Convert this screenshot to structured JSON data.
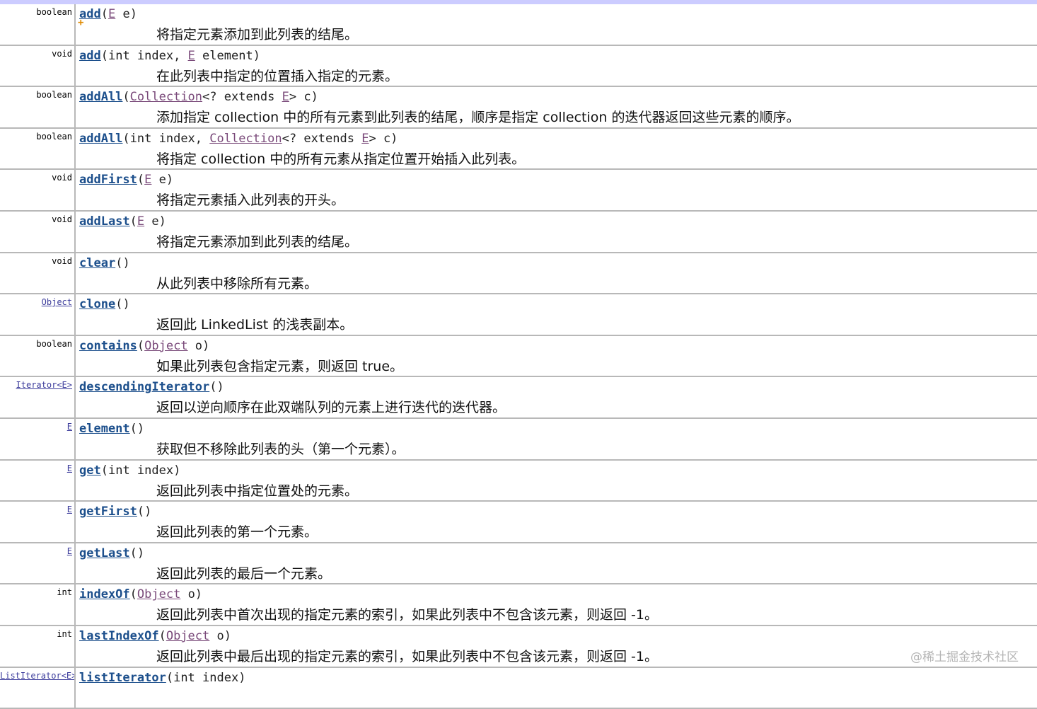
{
  "rows": [
    {
      "ret": "boolean",
      "ret_link": false,
      "method": "add",
      "params": [
        {
          "t": "p",
          "v": "E"
        },
        {
          "t": "s",
          "v": " e)"
        }
      ],
      "desc": "将指定元素添加到此列表的结尾。"
    },
    {
      "ret": "void",
      "ret_link": false,
      "method": "add",
      "params": [
        {
          "t": "s",
          "v": "int index, "
        },
        {
          "t": "p",
          "v": "E"
        },
        {
          "t": "s",
          "v": " element)"
        }
      ],
      "desc": "在此列表中指定的位置插入指定的元素。"
    },
    {
      "ret": "boolean",
      "ret_link": false,
      "method": "addAll",
      "params": [
        {
          "t": "p",
          "v": "Collection"
        },
        {
          "t": "s",
          "v": "<? extends "
        },
        {
          "t": "p",
          "v": "E"
        },
        {
          "t": "s",
          "v": "> c)"
        }
      ],
      "desc": "添加指定 collection 中的所有元素到此列表的结尾，顺序是指定 collection 的迭代器返回这些元素的顺序。"
    },
    {
      "ret": "boolean",
      "ret_link": false,
      "method": "addAll",
      "params": [
        {
          "t": "s",
          "v": "int index, "
        },
        {
          "t": "p",
          "v": "Collection"
        },
        {
          "t": "s",
          "v": "<? extends "
        },
        {
          "t": "p",
          "v": "E"
        },
        {
          "t": "s",
          "v": "> c)"
        }
      ],
      "desc": "将指定 collection 中的所有元素从指定位置开始插入此列表。"
    },
    {
      "ret": "void",
      "ret_link": false,
      "method": "addFirst",
      "params": [
        {
          "t": "p",
          "v": "E"
        },
        {
          "t": "s",
          "v": " e)"
        }
      ],
      "desc": "将指定元素插入此列表的开头。"
    },
    {
      "ret": "void",
      "ret_link": false,
      "method": "addLast",
      "params": [
        {
          "t": "p",
          "v": "E"
        },
        {
          "t": "s",
          "v": " e)"
        }
      ],
      "desc": "将指定元素添加到此列表的结尾。"
    },
    {
      "ret": "void",
      "ret_link": false,
      "method": "clear",
      "params": [
        {
          "t": "s",
          "v": ")"
        }
      ],
      "desc": "从此列表中移除所有元素。"
    },
    {
      "ret": "Object",
      "ret_link": true,
      "method": "clone",
      "params": [
        {
          "t": "s",
          "v": ")"
        }
      ],
      "desc": "返回此 LinkedList 的浅表副本。"
    },
    {
      "ret": "boolean",
      "ret_link": false,
      "method": "contains",
      "params": [
        {
          "t": "p",
          "v": "Object"
        },
        {
          "t": "s",
          "v": " o)"
        }
      ],
      "desc": "如果此列表包含指定元素，则返回 true。"
    },
    {
      "ret": "Iterator<E>",
      "ret_link": true,
      "method": "descendingIterator",
      "params": [
        {
          "t": "s",
          "v": ")"
        }
      ],
      "desc": "返回以逆向顺序在此双端队列的元素上进行迭代的迭代器。"
    },
    {
      "ret": "E",
      "ret_link": true,
      "method": "element",
      "params": [
        {
          "t": "s",
          "v": ")"
        }
      ],
      "desc": "获取但不移除此列表的头（第一个元素）。"
    },
    {
      "ret": "E",
      "ret_link": true,
      "method": "get",
      "params": [
        {
          "t": "s",
          "v": "int index)"
        }
      ],
      "desc": "返回此列表中指定位置处的元素。"
    },
    {
      "ret": "E",
      "ret_link": true,
      "method": "getFirst",
      "params": [
        {
          "t": "s",
          "v": ")"
        }
      ],
      "desc": "返回此列表的第一个元素。"
    },
    {
      "ret": "E",
      "ret_link": true,
      "method": "getLast",
      "params": [
        {
          "t": "s",
          "v": ")"
        }
      ],
      "desc": "返回此列表的最后一个元素。"
    },
    {
      "ret": "int",
      "ret_link": false,
      "method": "indexOf",
      "params": [
        {
          "t": "p",
          "v": "Object"
        },
        {
          "t": "s",
          "v": " o)"
        }
      ],
      "desc": "返回此列表中首次出现的指定元素的索引，如果此列表中不包含该元素，则返回 -1。"
    },
    {
      "ret": "int",
      "ret_link": false,
      "method": "lastIndexOf",
      "params": [
        {
          "t": "p",
          "v": "Object"
        },
        {
          "t": "s",
          "v": " o)"
        }
      ],
      "desc": "返回此列表中最后出现的指定元素的索引，如果此列表中不包含该元素，则返回 -1。"
    },
    {
      "ret": "ListIterator<E>",
      "ret_link": true,
      "method": "listIterator",
      "params": [
        {
          "t": "s",
          "v": "int index)"
        }
      ],
      "desc": ""
    }
  ],
  "watermark": "@稀土掘金技术社区"
}
